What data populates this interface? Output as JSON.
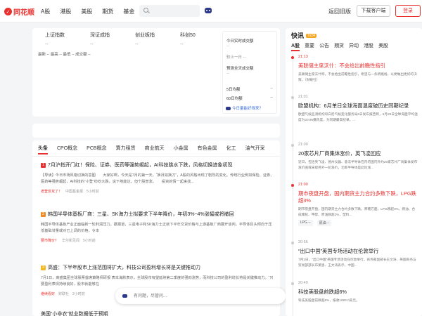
{
  "header": {
    "logo_text": "同花顺",
    "nav": [
      "A股",
      "港股",
      "美股",
      "期货",
      "基金"
    ],
    "search_placeholder": "",
    "back_old": "返回旧版",
    "download": "下载客户端",
    "login": "登录"
  },
  "market": {
    "indices": [
      {
        "name": "上证指数",
        "value": "--"
      },
      {
        "name": "深证成指",
        "value": "--"
      },
      {
        "name": "创业板指",
        "value": "--"
      },
      {
        "name": "科创50",
        "value": "--"
      }
    ],
    "breadth": [
      "最新 -- 最高 -- 最低 -- 成交额 --"
    ],
    "panel": {
      "today_volume_label": "今日实时成交额",
      "today_volume_value": "--",
      "compare_label": "较上一日 --",
      "forecast_label": "预测全天成交额",
      "forecast_value": "--",
      "rise_label": "5日均额",
      "rise_value": "--",
      "avg_label": "60日均额",
      "avg_value": "--",
      "link": "今日量能好得来？"
    }
  },
  "feed": {
    "tabs": [
      "头条",
      "CPO概念",
      "PCB概念",
      "算力租赁",
      "商业航天",
      "小金属",
      "有色金属",
      "化工",
      "油气开采"
    ],
    "articles": [
      {
        "rank": "1",
        "rank_color": "#e8312f",
        "title": "7月沪指开门红！保险、证券、医药等强势崛起，AI科技跳水下跌，风格切换迹象初现",
        "body": "【导读】今日市场风格切换的意图　　大家好啊，今天是7月的第一天，“换月如换刀”，A股的风格出现了剧烈的变化。传统行业例如保险、证券、医药等强势崛起，AI科技的“小登”纷纷大跌，说下地能达，但个股普涨。　　投资的情一起来找...",
        "tag": "老登反攻了！",
        "source": "中国基金报",
        "time": "5小时前"
      },
      {
        "rank": "2",
        "rank_color": "#f08a24",
        "title": "韩国半导体基板厂商：三星、SK海力士拟要求下半年降价，年初3%~4%涨幅或将撤回",
        "body": "韩国半导体基板产业正面临新一轮利润压力。据报道，三星电子和SK海力士正就下半年交货价格与上游基板厂商展开谈判，半导体巨头倾向于压低基础甘量或对已上调的价格，令本",
        "tag": "要市降价？",
        "source": "华尔街见闻",
        "time": "5小时前"
      },
      {
        "rank": "3",
        "rank_color": "#f5b623",
        "title": "高盛：下半年股市上涨范围将扩大，科技公司盈利增长将是关键推动力",
        "body": "7月1日，高盛集团全球股票首席策略师研报 表本海默表示，全球股市有望延续第二季度的强劲涨势，而科技公司的盈利增长将是关键推动力。“只要盈利表现持续良好，股市就能够在",
        "tag": "继续看好",
        "source": "财联社",
        "time": "2小时前"
      },
      {
        "rank": "",
        "rank_color": "",
        "title": "美国“小非农”就业数据低于预期",
        "body": "",
        "tag": "",
        "source": "",
        "time": ""
      }
    ],
    "ask_placeholder": "有问题，尽管问..."
  },
  "flash": {
    "title": "快讯",
    "badge": "7x24",
    "tabs": [
      "A股",
      "重要",
      "公告",
      "期货",
      "异动",
      "港股",
      "美股"
    ],
    "items": [
      {
        "time": "21:13",
        "red": true,
        "title": "美联储主席沃什：不会给出前瞻性指引",
        "body": "美联储主席沃什称，不会给出前瞻性指引，希望与一条新路线，以便做出更好的决策。（财联社）",
        "tags": []
      },
      {
        "time": "21:01",
        "red": false,
        "title": "欧盟机构：6月单日全球海面温度破历史同期纪录",
        "body": "欧盟气候监测机构哥白尼气候变化服务局6日发布报告称，6月29日全球海面平均温度为20.96摄氏度，为同期最高纪录。...",
        "tags": []
      },
      {
        "time": "21:00",
        "red": false,
        "title": "20家芯片厂商集体涨价，英飞凌回应",
        "body": "近日，包括英飞凌、德州仪器、意法半导体在内的国内外约20家芯片厂商集体发布涨价函或采取另外一轮涨价，功率半导体是此轮涨...",
        "tags": []
      },
      {
        "time": "21:00",
        "red": true,
        "title": "期市夜盘开盘，国内期货主力合约多数下跌，LPG跌超3%",
        "body": "期市夜盘开盘，国内期货主力合约多数下跌。原糖方面，LPG跌超3%，燃油、合成橡胶、甲醇、原油跌超2%，塑料...",
        "tags": [
          "LPG --",
          "原油 --"
        ]
      },
      {
        "time": "20:56",
        "red": false,
        "title": "“出口中国”英国专场活动在伦敦举行",
        "body": "7月1日，“出口中国”英国专场活动在伦敦举行。商务部副部长王文涛、英国商务与贸易部部长布莱恩、王文涛表示，中国...",
        "tags": []
      },
      {
        "time": "20:49",
        "red": false,
        "title": "科技美股盘前跌超6%",
        "body": "科技美股盘前跌超6%，报收1083.0美元。",
        "tags": []
      }
    ]
  }
}
